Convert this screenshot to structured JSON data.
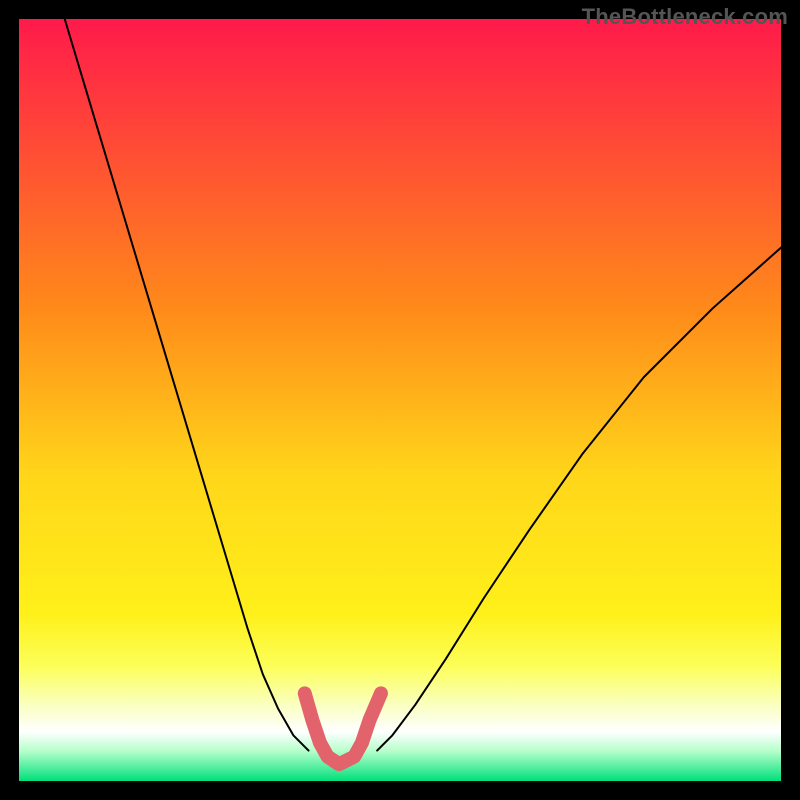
{
  "watermark": "TheBottleneck.com",
  "chart_data": {
    "type": "line",
    "title": "",
    "xlabel": "",
    "ylabel": "",
    "xlim": [
      0,
      1
    ],
    "ylim": [
      0,
      1
    ],
    "grid": false,
    "gradient_stops": [
      {
        "offset": 0.0,
        "color": "#ff1a4b"
      },
      {
        "offset": 0.38,
        "color": "#ff8a1a"
      },
      {
        "offset": 0.6,
        "color": "#ffd61a"
      },
      {
        "offset": 0.78,
        "color": "#fff01a"
      },
      {
        "offset": 0.85,
        "color": "#fcff5a"
      },
      {
        "offset": 0.9,
        "color": "#faffc0"
      },
      {
        "offset": 0.935,
        "color": "#ffffff"
      },
      {
        "offset": 0.96,
        "color": "#b8ffcc"
      },
      {
        "offset": 1.0,
        "color": "#00e07a"
      }
    ],
    "series": [
      {
        "name": "bottleneck-curve-left",
        "color": "#000000",
        "width": 2,
        "x": [
          0.06,
          0.09,
          0.12,
          0.15,
          0.18,
          0.21,
          0.24,
          0.27,
          0.3,
          0.32,
          0.34,
          0.36,
          0.38
        ],
        "y": [
          1.0,
          0.9,
          0.8,
          0.7,
          0.6,
          0.5,
          0.4,
          0.3,
          0.2,
          0.14,
          0.095,
          0.06,
          0.04
        ]
      },
      {
        "name": "bottleneck-curve-right",
        "color": "#000000",
        "width": 2,
        "x": [
          0.47,
          0.49,
          0.52,
          0.56,
          0.61,
          0.67,
          0.74,
          0.82,
          0.91,
          1.0
        ],
        "y": [
          0.04,
          0.06,
          0.1,
          0.16,
          0.24,
          0.33,
          0.43,
          0.53,
          0.62,
          0.7
        ]
      },
      {
        "name": "highlight-u",
        "color": "#e2636b",
        "width": 14,
        "x": [
          0.375,
          0.385,
          0.395,
          0.405,
          0.42,
          0.44,
          0.45,
          0.46,
          0.475
        ],
        "y": [
          0.115,
          0.08,
          0.05,
          0.032,
          0.022,
          0.032,
          0.05,
          0.08,
          0.115
        ]
      }
    ]
  }
}
